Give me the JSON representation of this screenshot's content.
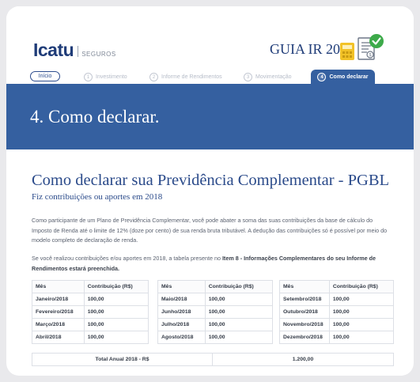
{
  "header": {
    "logo_main": "Icatu",
    "logo_sub": "SEGUROS",
    "guia_title": "GUIA IR 2019"
  },
  "tabs": [
    {
      "label": "Início"
    },
    {
      "num": "1",
      "label": "Investimento"
    },
    {
      "num": "2",
      "label": "Informe de Rendimentos"
    },
    {
      "num": "3",
      "label": "Movimentação"
    },
    {
      "num": "4",
      "label": "Como declarar"
    }
  ],
  "banner": {
    "title": "4. Como declarar."
  },
  "main": {
    "heading": "Como declarar sua Previdência Complementar - PGBL",
    "subtitle": "Fiz contribuições ou aportes em 2018",
    "paragraph1": "Como participante de um Plano de Previdência Complementar, você pode abater a soma das suas contribuições da base de cálculo do Imposto de Renda até o limite de 12% (doze por cento) de sua renda bruta tributável. A dedução das contribuições só é possível por meio do modelo completo de declaração de renda.",
    "paragraph2_pre": "Se você realizou contribuições e/ou aportes em 2018, a tabela presente no ",
    "paragraph2_bold": "Item 8 - Informações Complementares do seu Informe de Rendimentos estará preenchida."
  },
  "table": {
    "col_mes": "Mês",
    "col_contrib": "Contribuição (R$)",
    "groups": [
      [
        {
          "mes": "Janeiro/2018",
          "valor": "100,00"
        },
        {
          "mes": "Fevereiro/2018",
          "valor": "100,00"
        },
        {
          "mes": "Março/2018",
          "valor": "100,00"
        },
        {
          "mes": "Abril/2018",
          "valor": "100,00"
        }
      ],
      [
        {
          "mes": "Maio/2018",
          "valor": "100,00"
        },
        {
          "mes": "Junho/2018",
          "valor": "100,00"
        },
        {
          "mes": "Julho/2018",
          "valor": "100,00"
        },
        {
          "mes": "Agosto/2018",
          "valor": "100,00"
        }
      ],
      [
        {
          "mes": "Setembro/2018",
          "valor": "100,00"
        },
        {
          "mes": "Outubro/2018",
          "valor": "100,00"
        },
        {
          "mes": "Novembro/2018",
          "valor": "100,00"
        },
        {
          "mes": "Dezembro/2018",
          "valor": "100,00"
        }
      ]
    ],
    "total_label": "Total Anual 2018 - R$",
    "total_value": "1.200,00"
  },
  "colors": {
    "brand_blue": "#3560a0",
    "text_blue": "#2a4a8a",
    "icon_yellow": "#f2c227",
    "icon_green": "#3daa4a"
  }
}
